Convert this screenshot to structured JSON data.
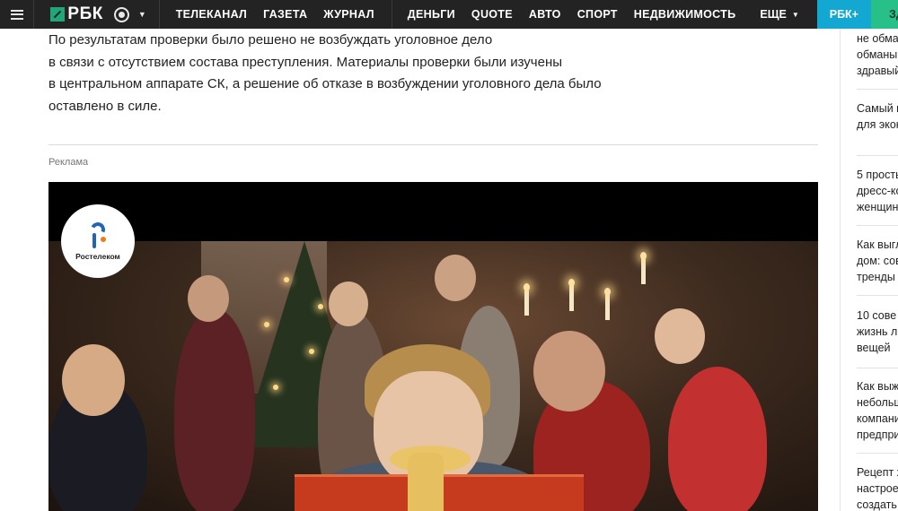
{
  "header": {
    "logo_text": "РБК",
    "primary_nav": [
      "ТЕЛЕКАНАЛ",
      "ГАЗЕТА",
      "ЖУРНАЛ"
    ],
    "secondary_nav": [
      "ДЕНЬГИ",
      "QUOTE",
      "АВТО",
      "СПОРТ",
      "НЕДВИЖИМОСТЬ"
    ],
    "more_label": "ЕЩЕ",
    "rbk_plus_label": "РБК+",
    "health_label": "ЗДОРОВЬЕ",
    "colors": {
      "bar": "#232323",
      "rbk_plus": "#12a8d2",
      "health": "#26c088"
    }
  },
  "article": {
    "paragraph_lines": [
      "По результатам проверки было решено не возбуждать уголовное дело",
      "в связи с отсутствием состава преступления. Материалы проверки были изучены",
      "в центральном аппарате СК, а решение об отказе в возбуждении уголовного дела было",
      "оставлено в силе."
    ]
  },
  "ad": {
    "label": "Реклама",
    "brand": "Ростелеком"
  },
  "sidebar": {
    "items": [
      {
        "lines": [
          "не обма",
          "обманы",
          "здравый"
        ]
      },
      {
        "lines": [
          "Самый в",
          "для экон"
        ]
      },
      {
        "lines": [
          "5 прость",
          "дресс-ко",
          "женщин"
        ]
      },
      {
        "lines": [
          "Как выгл",
          "дом: сов",
          "тренды"
        ]
      },
      {
        "lines": [
          "10 сове",
          "жизнь л",
          "вещей"
        ]
      },
      {
        "lines": [
          "Как выж",
          "небольш",
          "компани",
          "предпри"
        ]
      },
      {
        "lines": [
          "Рецепт х",
          "настрое",
          "создать"
        ]
      }
    ]
  },
  "icons": [
    "menu-icon",
    "globe-icon",
    "chevron-down-icon",
    "rostelecom-logo-icon"
  ]
}
